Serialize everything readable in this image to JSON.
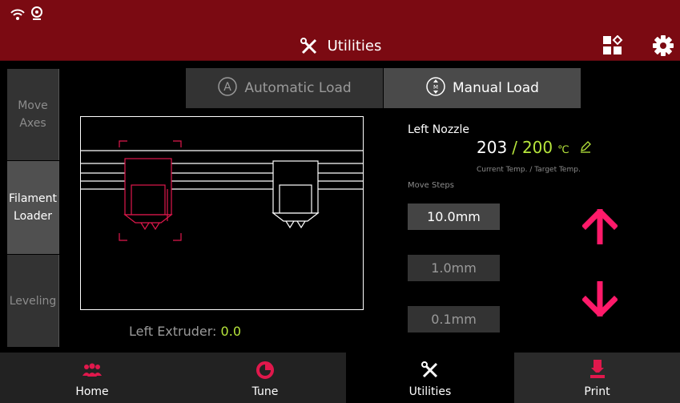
{
  "header": {
    "title": "Utilities"
  },
  "side_nav": [
    {
      "label": "Move Axes"
    },
    {
      "label": "Filament Loader"
    },
    {
      "label": "Leveling"
    }
  ],
  "load_tabs": {
    "automatic": "Automatic Load",
    "manual": "Manual Load"
  },
  "nozzle": {
    "label": "Left Nozzle",
    "current_temp": "203",
    "separator": "/",
    "target_temp": "200",
    "unit": "℃",
    "caption": "Current Temp. / Target Temp."
  },
  "move_steps": {
    "label": "Move Steps",
    "options": [
      "10.0mm",
      "1.0mm",
      "0.1mm"
    ],
    "selected": "10.0mm"
  },
  "extruder": {
    "label": "Left Extruder:",
    "value": "0.0"
  },
  "bottom_nav": {
    "home": "Home",
    "tune": "Tune",
    "utilities": "Utilities",
    "print": "Print"
  },
  "colors": {
    "header_bg": "#7b0a12",
    "accent_green": "#b7e63c",
    "arrow_pink": "#ff1a6a",
    "nozzle_red": "#e0184c"
  }
}
